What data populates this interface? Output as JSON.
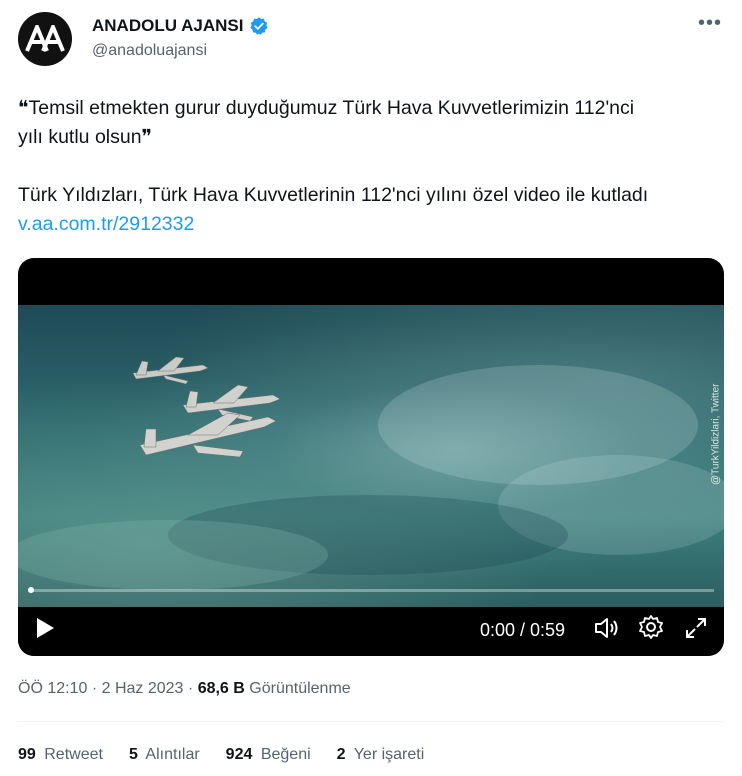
{
  "author": {
    "name": "ANADOLU AJANSI",
    "handle": "@anadoluajansi",
    "avatar_text": "AA",
    "verified_color": "#1d9bf0"
  },
  "more_label": "•••",
  "tweet": {
    "line1": "❝Temsil etmekten gurur duyduğumuz Türk Hava Kuvvetlerimizin 112'nci",
    "line2": "yılı kutlu olsun❞",
    "line3": "Türk Yıldızları, Türk Hava Kuvvetlerinin 112'nci yılını özel video ile kutladı",
    "link": "v.aa.com.tr/2912332"
  },
  "video": {
    "watermark": "@TurkYildizlari, Twitter",
    "time": "0:00 / 0:59",
    "progress_fraction": 0.0
  },
  "meta": {
    "time": "ÖÖ 12:10",
    "sep": "·",
    "date": "2 Haz 2023",
    "views_count": "68,6 B",
    "views_label": "Görüntülenme"
  },
  "stats": {
    "retweets": {
      "count": "99",
      "label": "Retweet"
    },
    "quotes": {
      "count": "5",
      "label": "Alıntılar"
    },
    "likes": {
      "count": "924",
      "label": "Beğeni"
    },
    "bookmarks": {
      "count": "2",
      "label": "Yer işareti"
    }
  }
}
